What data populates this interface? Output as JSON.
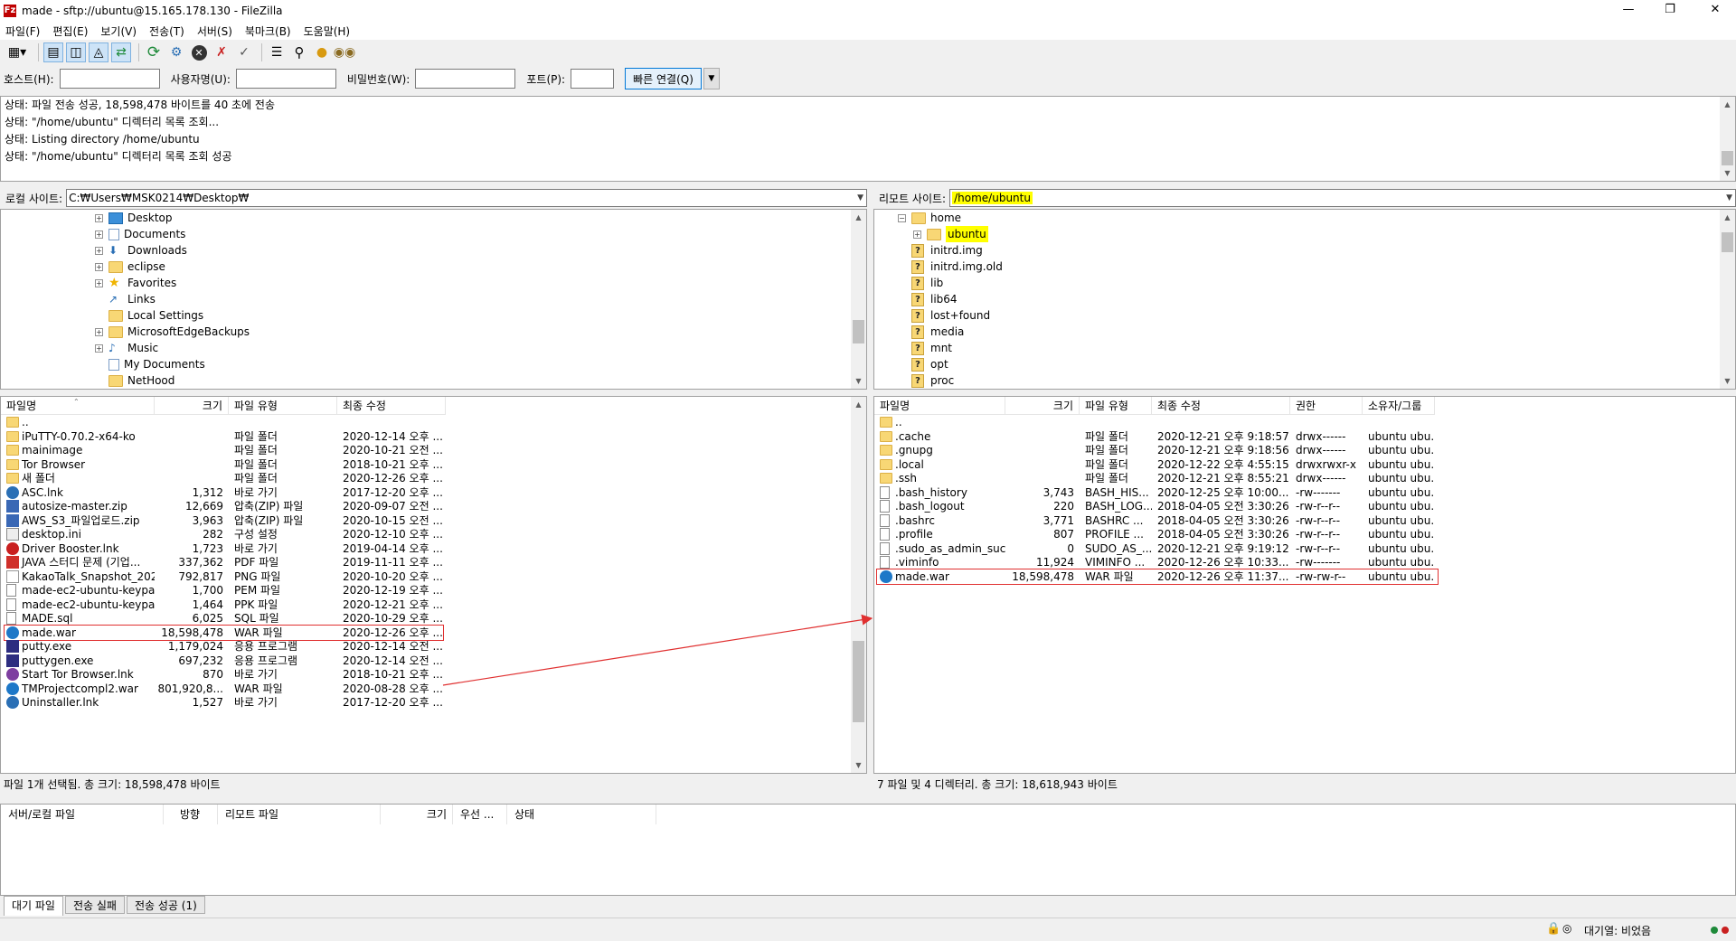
{
  "window": {
    "title": "made - sftp://ubuntu@15.165.178.130 - FileZilla",
    "app_icon": "Fz"
  },
  "menu": [
    "파일(F)",
    "편집(E)",
    "보기(V)",
    "전송(T)",
    "서버(S)",
    "북마크(B)",
    "도움말(H)"
  ],
  "quickconnect": {
    "host_label": "호스트(H):",
    "user_label": "사용자명(U):",
    "pass_label": "비밀번호(W):",
    "port_label": "포트(P):",
    "host_value": "",
    "user_value": "",
    "pass_value": "",
    "port_value": "",
    "connect_button": "빠른 연결(Q)"
  },
  "log": [
    "상태:    파일 전송 성공, 18,598,478 바이트를 40 초에 전송",
    "상태:    \"/home/ubuntu\" 디렉터리 목록 조회...",
    "상태:    Listing directory /home/ubuntu",
    "상태:    \"/home/ubuntu\" 디렉터리 목록 조회 성공"
  ],
  "local": {
    "site_label": "로컬 사이트:",
    "path": "C:₩Users₩MSK0214₩Desktop₩",
    "tree": [
      {
        "label": "Desktop",
        "icon": "folder-blue",
        "expander": "+"
      },
      {
        "label": "Documents",
        "icon": "documents-icon",
        "expander": "+"
      },
      {
        "label": "Downloads",
        "icon": "downloads-icon",
        "expander": "+"
      },
      {
        "label": "eclipse",
        "icon": "folder",
        "expander": "+"
      },
      {
        "label": "Favorites",
        "icon": "star-icon",
        "expander": "+"
      },
      {
        "label": "Links",
        "icon": "links-icon",
        "expander": ""
      },
      {
        "label": "Local Settings",
        "icon": "folder",
        "expander": ""
      },
      {
        "label": "MicrosoftEdgeBackups",
        "icon": "folder",
        "expander": "+"
      },
      {
        "label": "Music",
        "icon": "music-icon",
        "expander": "+"
      },
      {
        "label": "My Documents",
        "icon": "documents-icon",
        "expander": ""
      },
      {
        "label": "NetHood",
        "icon": "folder",
        "expander": ""
      }
    ],
    "columns": [
      "파일명",
      "크기",
      "파일 유형",
      "최종 수정"
    ],
    "files": [
      {
        "name": "..",
        "size": "",
        "type": "",
        "modified": "",
        "icon": "folder"
      },
      {
        "name": "iPuTTY-0.70.2-x64-ko",
        "size": "",
        "type": "파일 폴더",
        "modified": "2020-12-14 오후 ...",
        "icon": "folder"
      },
      {
        "name": "mainimage",
        "size": "",
        "type": "파일 폴더",
        "modified": "2020-10-21 오전 ...",
        "icon": "folder"
      },
      {
        "name": "Tor Browser",
        "size": "",
        "type": "파일 폴더",
        "modified": "2018-10-21 오후 ...",
        "icon": "folder"
      },
      {
        "name": "새 폴더",
        "size": "",
        "type": "파일 폴더",
        "modified": "2020-12-26 오후 ...",
        "icon": "folder"
      },
      {
        "name": "ASC.lnk",
        "size": "1,312",
        "type": "바로 가기",
        "modified": "2017-12-20 오후 ...",
        "icon": "link"
      },
      {
        "name": "autosize-master.zip",
        "size": "12,669",
        "type": "압축(ZIP) 파일",
        "modified": "2020-09-07 오전 ...",
        "icon": "zip"
      },
      {
        "name": "AWS_S3_파일업로드.zip",
        "size": "3,963",
        "type": "압축(ZIP) 파일",
        "modified": "2020-10-15 오전 ...",
        "icon": "zip"
      },
      {
        "name": "desktop.ini",
        "size": "282",
        "type": "구성 설정",
        "modified": "2020-12-10 오후 ...",
        "icon": "ini"
      },
      {
        "name": "Driver Booster.lnk",
        "size": "1,723",
        "type": "바로 가기",
        "modified": "2019-04-14 오후 ...",
        "icon": "red"
      },
      {
        "name": "JAVA 스터디 문제 (기업...",
        "size": "337,362",
        "type": "PDF 파일",
        "modified": "2019-11-11 오후 ...",
        "icon": "pdf"
      },
      {
        "name": "KakaoTalk_Snapshot_202...",
        "size": "792,817",
        "type": "PNG 파일",
        "modified": "2020-10-20 오후 ...",
        "icon": "png"
      },
      {
        "name": "made-ec2-ubuntu-keypai...",
        "size": "1,700",
        "type": "PEM 파일",
        "modified": "2020-12-19 오후 ...",
        "icon": "file"
      },
      {
        "name": "made-ec2-ubuntu-keypai...",
        "size": "1,464",
        "type": "PPK 파일",
        "modified": "2020-12-21 오후 ...",
        "icon": "file"
      },
      {
        "name": "MADE.sql",
        "size": "6,025",
        "type": "SQL 파일",
        "modified": "2020-10-29 오후 ...",
        "icon": "file"
      },
      {
        "name": "made.war",
        "size": "18,598,478",
        "type": "WAR 파일",
        "modified": "2020-12-26 오후 ...",
        "icon": "war"
      },
      {
        "name": "putty.exe",
        "size": "1,179,024",
        "type": "응용 프로그램",
        "modified": "2020-12-14 오전 ...",
        "icon": "exe"
      },
      {
        "name": "puttygen.exe",
        "size": "697,232",
        "type": "응용 프로그램",
        "modified": "2020-12-14 오전 ...",
        "icon": "exe"
      },
      {
        "name": "Start Tor Browser.lnk",
        "size": "870",
        "type": "바로 가기",
        "modified": "2018-10-21 오후 ...",
        "icon": "tor"
      },
      {
        "name": "TMProjectcompl2.war",
        "size": "801,920,8...",
        "type": "WAR 파일",
        "modified": "2020-08-28 오후 ...",
        "icon": "war"
      },
      {
        "name": "Uninstaller.lnk",
        "size": "1,527",
        "type": "바로 가기",
        "modified": "2017-12-20 오후 ...",
        "icon": "link"
      }
    ],
    "status": "파일 1개 선택됨. 총 크기: 18,598,478 바이트"
  },
  "remote": {
    "site_label": "리모트 사이트:",
    "path": "/home/ubuntu",
    "tree": [
      {
        "label": "home",
        "icon": "folder",
        "expander": "−",
        "indent": 0
      },
      {
        "label": "ubuntu",
        "icon": "folder",
        "expander": "+",
        "indent": 1,
        "highlight": true
      },
      {
        "label": "initrd.img",
        "icon": "question",
        "expander": "",
        "indent": 0
      },
      {
        "label": "initrd.img.old",
        "icon": "question",
        "expander": "",
        "indent": 0
      },
      {
        "label": "lib",
        "icon": "question",
        "expander": "",
        "indent": 0
      },
      {
        "label": "lib64",
        "icon": "question",
        "expander": "",
        "indent": 0
      },
      {
        "label": "lost+found",
        "icon": "question",
        "expander": "",
        "indent": 0
      },
      {
        "label": "media",
        "icon": "question",
        "expander": "",
        "indent": 0
      },
      {
        "label": "mnt",
        "icon": "question",
        "expander": "",
        "indent": 0
      },
      {
        "label": "opt",
        "icon": "question",
        "expander": "",
        "indent": 0
      },
      {
        "label": "proc",
        "icon": "question",
        "expander": "",
        "indent": 0
      }
    ],
    "columns": [
      "파일명",
      "크기",
      "파일 유형",
      "최종 수정",
      "권한",
      "소유자/그룹"
    ],
    "files": [
      {
        "name": "..",
        "size": "",
        "type": "",
        "modified": "",
        "perm": "",
        "owner": "",
        "icon": "folder"
      },
      {
        "name": ".cache",
        "size": "",
        "type": "파일 폴더",
        "modified": "2020-12-21 오후 9:18:57",
        "perm": "drwx------",
        "owner": "ubuntu ubu...",
        "icon": "folder"
      },
      {
        "name": ".gnupg",
        "size": "",
        "type": "파일 폴더",
        "modified": "2020-12-21 오후 9:18:56",
        "perm": "drwx------",
        "owner": "ubuntu ubu...",
        "icon": "folder"
      },
      {
        "name": ".local",
        "size": "",
        "type": "파일 폴더",
        "modified": "2020-12-22 오후 4:55:15",
        "perm": "drwxrwxr-x",
        "owner": "ubuntu ubu...",
        "icon": "folder"
      },
      {
        "name": ".ssh",
        "size": "",
        "type": "파일 폴더",
        "modified": "2020-12-21 오후 8:55:21",
        "perm": "drwx------",
        "owner": "ubuntu ubu...",
        "icon": "folder"
      },
      {
        "name": ".bash_history",
        "size": "3,743",
        "type": "BASH_HIS...",
        "modified": "2020-12-25 오후 10:00...",
        "perm": "-rw-------",
        "owner": "ubuntu ubu...",
        "icon": "file"
      },
      {
        "name": ".bash_logout",
        "size": "220",
        "type": "BASH_LOG...",
        "modified": "2018-04-05 오전 3:30:26",
        "perm": "-rw-r--r--",
        "owner": "ubuntu ubu...",
        "icon": "file"
      },
      {
        "name": ".bashrc",
        "size": "3,771",
        "type": "BASHRC ...",
        "modified": "2018-04-05 오전 3:30:26",
        "perm": "-rw-r--r--",
        "owner": "ubuntu ubu...",
        "icon": "file"
      },
      {
        "name": ".profile",
        "size": "807",
        "type": "PROFILE ...",
        "modified": "2018-04-05 오전 3:30:26",
        "perm": "-rw-r--r--",
        "owner": "ubuntu ubu...",
        "icon": "file"
      },
      {
        "name": ".sudo_as_admin_succ...",
        "size": "0",
        "type": "SUDO_AS_...",
        "modified": "2020-12-21 오후 9:19:12",
        "perm": "-rw-r--r--",
        "owner": "ubuntu ubu...",
        "icon": "file"
      },
      {
        "name": ".viminfo",
        "size": "11,924",
        "type": "VIMINFO ...",
        "modified": "2020-12-26 오후 10:33...",
        "perm": "-rw-------",
        "owner": "ubuntu ubu...",
        "icon": "file"
      },
      {
        "name": "made.war",
        "size": "18,598,478",
        "type": "WAR 파일",
        "modified": "2020-12-26 오후 11:37...",
        "perm": "-rw-rw-r--",
        "owner": "ubuntu ubu...",
        "icon": "war"
      }
    ],
    "status": "7 파일 및 4 디렉터리. 총 크기: 18,618,943 바이트"
  },
  "queue": {
    "columns": [
      "서버/로컬 파일",
      "방향",
      "리모트 파일",
      "크기",
      "우선 ...",
      "상태"
    ],
    "tabs": [
      "대기 파일",
      "전송 실패",
      "전송 성공 (1)"
    ]
  },
  "statusbar": {
    "queue_text": "대기열: 비었음"
  },
  "colors": {
    "highlight": "#ffff00",
    "annotation": "#e03030",
    "accent": "#0078d7"
  }
}
